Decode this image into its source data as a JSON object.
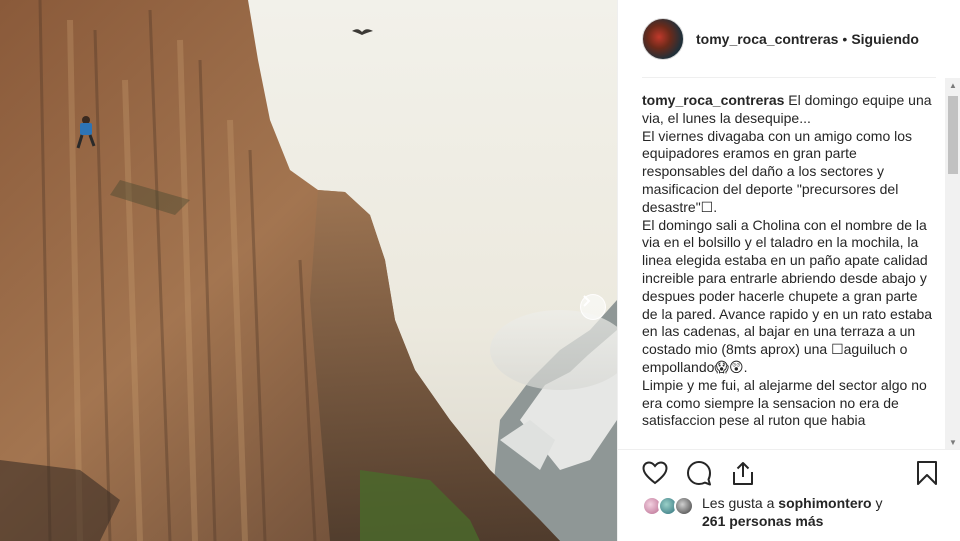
{
  "post": {
    "username": "tomy_roca_contreras",
    "separator": "•",
    "follow_status": "Siguiendo",
    "caption_user": "tomy_roca_contreras",
    "caption_lines": [
      "El domingo equipe una via, el lunes la desequipe...",
      "El viernes divagaba con un amigo como los equipadores eramos en gran parte responsables del daño a los sectores y masificacion del deporte \"precursores del desastre\"☐.",
      "El domingo sali a Cholina con el nombre de la via en el bolsillo y el taladro en la mochila, la linea elegida estaba en un paño apate calidad increible para entrarle abriendo desde abajo y despues poder hacerle chupete a gran parte de la pared. Avance rapido y en un rato estaba en las cadenas, al bajar en una terraza a un costado mio (8mts aprox) una ☐aguiluch o empollando😱😲.",
      "Limpie y me fui, al alejarme del sector algo no era como siempre la sensacion no era de satisfaccion pese al ruton que habia"
    ]
  },
  "likes": {
    "prefix": "Les gusta a",
    "first_liker": "sophimontero",
    "conjunction": "y",
    "others": "261 personas más"
  },
  "icons": {
    "next": "chevron-right-icon",
    "like": "heart-icon",
    "comment": "comment-icon",
    "share": "share-icon",
    "save": "bookmark-icon"
  },
  "colors": {
    "text": "#262626",
    "separator": "#efefef",
    "scroll_track": "#f1f1f1",
    "scroll_thumb": "#c1c1c1"
  }
}
